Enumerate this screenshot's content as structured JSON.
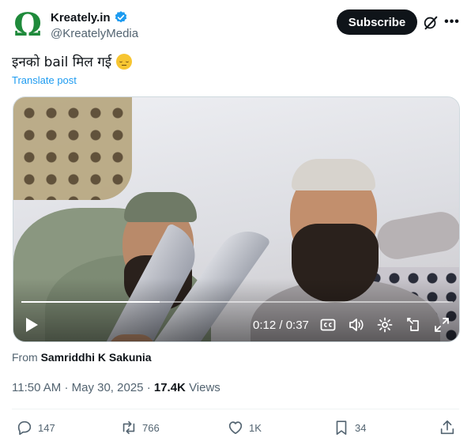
{
  "account": {
    "display_name": "Kreately.in",
    "handle": "@KreatelyMedia",
    "avatar_icon": "omega-logo-icon",
    "verified_color": "#1d9bf0"
  },
  "header": {
    "subscribe_label": "Subscribe",
    "grok_icon": "grok-icon",
    "more_icon": "more-icon"
  },
  "post": {
    "text": "इनको bail मिल गई",
    "emoji": "pensive-face",
    "translate_label": "Translate post"
  },
  "video": {
    "time_label": "0:12 / 0:37",
    "progress_fraction": 0.32,
    "controls": [
      "play-icon",
      "captions-icon",
      "volume-icon",
      "settings-icon",
      "popout-icon",
      "fullscreen-icon"
    ]
  },
  "attribution": {
    "from_label": "From",
    "author": "Samriddhi K Sakunia"
  },
  "meta": {
    "time": "11:50 AM",
    "separator": "·",
    "date": "May 30, 2025",
    "views_count": "17.4K",
    "views_label": "Views"
  },
  "actions": {
    "replies": "147",
    "reposts": "766",
    "likes": "1K",
    "bookmarks": "34"
  },
  "colors": {
    "accent": "#1d9bf0",
    "text_primary": "#0f1419",
    "text_secondary": "#536471",
    "logo_green": "#1f8a3b"
  }
}
